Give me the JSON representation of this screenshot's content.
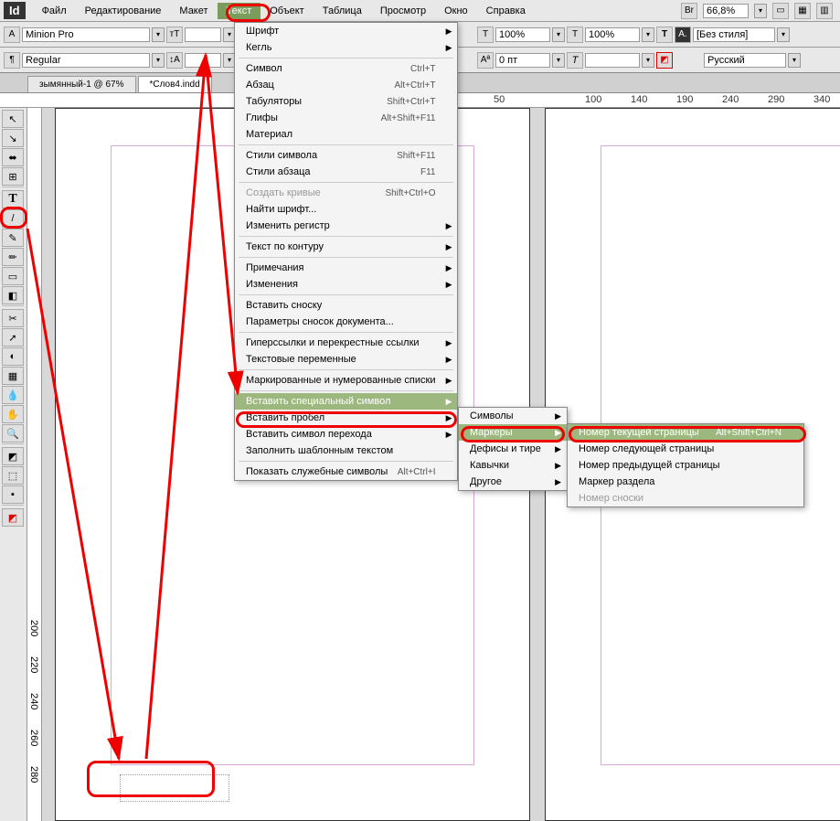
{
  "app_logo": "Id",
  "menubar": [
    "Файл",
    "Редактирование",
    "Макет",
    "Текст",
    "Объект",
    "Таблица",
    "Просмотр",
    "Окно",
    "Справка"
  ],
  "menubar_active_index": 3,
  "zoom_display": "66,8%",
  "toolbar1": {
    "font": "Minion Pro",
    "style": "Regular",
    "size": "",
    "scale_h": "100%",
    "scale_v": "100%",
    "tracking": "0 пт",
    "char_style": "[Без стиля]",
    "language": "Русский"
  },
  "tabs": [
    {
      "label": "зымянный-1 @ 67%",
      "active": false
    },
    {
      "label": "*Слов4.indd",
      "active": true
    }
  ],
  "ruler_marks_h": [
    "50",
    "100",
    "140",
    "190",
    "240",
    "290",
    "340"
  ],
  "ruler_marks_v": [
    "200",
    "220",
    "240",
    "260",
    "280"
  ],
  "text_menu": {
    "groups": [
      [
        {
          "label": "Шрифт",
          "arrow": true
        },
        {
          "label": "Кегль",
          "arrow": true
        }
      ],
      [
        {
          "label": "Символ",
          "shortcut": "Ctrl+T"
        },
        {
          "label": "Абзац",
          "shortcut": "Alt+Ctrl+T"
        },
        {
          "label": "Табуляторы",
          "shortcut": "Shift+Ctrl+T"
        },
        {
          "label": "Глифы",
          "shortcut": "Alt+Shift+F11"
        },
        {
          "label": "Материал"
        }
      ],
      [
        {
          "label": "Стили символа",
          "shortcut": "Shift+F11"
        },
        {
          "label": "Стили абзаца",
          "shortcut": "F11"
        }
      ],
      [
        {
          "label": "Создать кривые",
          "shortcut": "Shift+Ctrl+O",
          "disabled": true
        },
        {
          "label": "Найти шрифт..."
        },
        {
          "label": "Изменить регистр",
          "arrow": true
        }
      ],
      [
        {
          "label": "Текст по контуру",
          "arrow": true
        }
      ],
      [
        {
          "label": "Примечания",
          "arrow": true
        },
        {
          "label": "Изменения",
          "arrow": true
        }
      ],
      [
        {
          "label": "Вставить сноску"
        },
        {
          "label": "Параметры сносок документа..."
        }
      ],
      [
        {
          "label": "Гиперссылки и перекрестные ссылки",
          "arrow": true
        },
        {
          "label": "Текстовые переменные",
          "arrow": true
        }
      ],
      [
        {
          "label": "Маркированные и нумерованные списки",
          "arrow": true
        }
      ],
      [
        {
          "label": "Вставить специальный символ",
          "arrow": true,
          "highlighted": true
        },
        {
          "label": "Вставить пробел",
          "arrow": true
        },
        {
          "label": "Вставить символ перехода",
          "arrow": true
        },
        {
          "label": "Заполнить шаблонным текстом"
        }
      ],
      [
        {
          "label": "Показать служебные символы",
          "shortcut": "Alt+Ctrl+I"
        }
      ]
    ]
  },
  "submenu1": [
    {
      "label": "Символы",
      "arrow": true
    },
    {
      "label": "Маркеры",
      "arrow": true,
      "highlighted": true
    },
    {
      "label": "Дефисы и тире",
      "arrow": true
    },
    {
      "label": "Кавычки",
      "arrow": true
    },
    {
      "label": "Другое",
      "arrow": true
    }
  ],
  "submenu2": [
    {
      "label": "Номер текущей страницы",
      "shortcut": "Alt+Shift+Ctrl+N",
      "highlighted": true
    },
    {
      "label": "Номер следующей страницы"
    },
    {
      "label": "Номер предыдущей страницы"
    },
    {
      "label": "Маркер раздела"
    },
    {
      "label": "Номер сноски",
      "disabled": true
    }
  ],
  "tools": [
    "↖",
    "↘",
    "⬌",
    "⊞",
    "T",
    "✎",
    "/",
    "◧",
    "▭",
    "✂",
    "➚",
    "◐",
    "▦",
    "✋",
    "🔍",
    "▭",
    "⬚",
    "◪",
    "◩"
  ]
}
